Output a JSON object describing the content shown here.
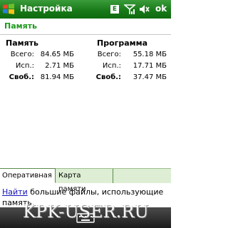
{
  "titlebar": {
    "title": "Настройка",
    "indicator_e": "E",
    "ok_label": "ok"
  },
  "page": {
    "heading": "Память"
  },
  "memory": {
    "header": "Память",
    "rows": [
      {
        "label": "Всего:",
        "value": "84.65 МБ"
      },
      {
        "label": "Исп.:",
        "value": "2.71 МБ"
      },
      {
        "label": "Своб.:",
        "value": "81.94 МБ"
      }
    ]
  },
  "program": {
    "header": "Программа",
    "rows": [
      {
        "label": "Всего:",
        "value": "55.18 МБ"
      },
      {
        "label": "Исп.:",
        "value": "17.71 МБ"
      },
      {
        "label": "Своб.:",
        "value": "37.47 МБ"
      }
    ]
  },
  "tabs": [
    {
      "label": "Оперативная",
      "active": true
    },
    {
      "label": "Карта памяти",
      "active": false
    }
  ],
  "footer": {
    "link": "Найти",
    "text": " большие файлы, использующие память."
  },
  "watermark": "KPK-USER.RU",
  "colors": {
    "titlebar": "#177817",
    "heading": "#1d9a1d",
    "link": "#1515b8"
  },
  "icons": [
    "windows-start-icon",
    "signal-icon",
    "volume-mute-icon",
    "keyboard-icon"
  ]
}
